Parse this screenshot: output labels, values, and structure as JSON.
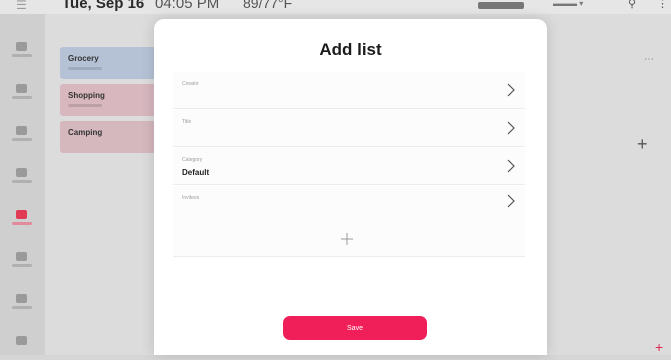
{
  "statusbar": {
    "date": "Tue, Sep 16",
    "time": "04:05 PM",
    "weather": "89/77°F"
  },
  "lists": [
    {
      "label": "Grocery"
    },
    {
      "label": "Shopping"
    },
    {
      "label": "Camping"
    }
  ],
  "modal": {
    "title": "Add list",
    "fields": [
      {
        "label": "Creator",
        "value": ""
      },
      {
        "label": "Title",
        "value": ""
      },
      {
        "label": "Category",
        "value": "Default"
      },
      {
        "label": "Invitees",
        "value": ""
      }
    ],
    "save_label": "Save"
  },
  "colors": {
    "accent": "#f01f5a",
    "card_blue": "#b5c2d6",
    "card_pink": "#d8b7bf"
  },
  "icons": [
    "menu-icon",
    "search-icon",
    "more-icon",
    "chevron-right-icon",
    "plus-icon"
  ]
}
